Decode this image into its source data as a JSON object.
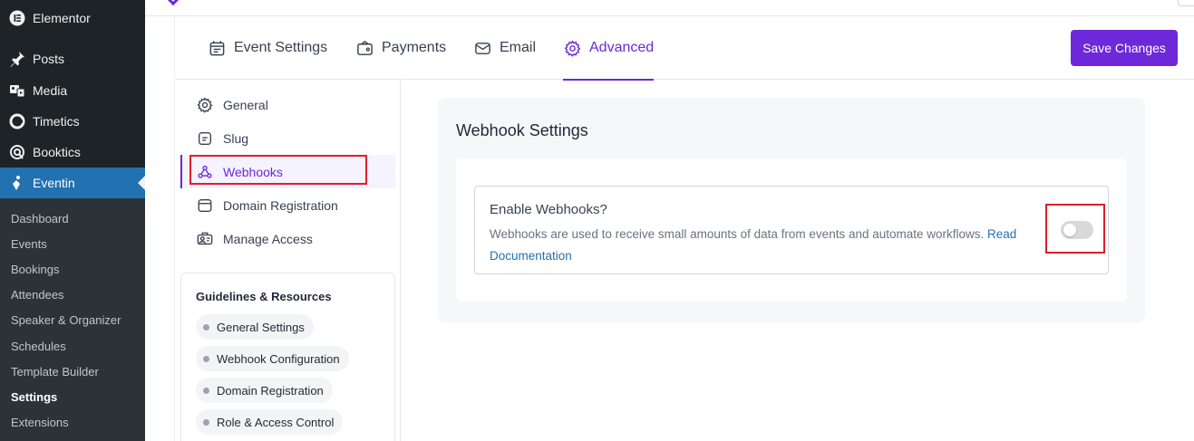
{
  "wp_menu": {
    "items": [
      {
        "label": "Elementor",
        "icon": "elementor-icon"
      },
      {
        "label": "Posts",
        "icon": "pin-icon"
      },
      {
        "label": "Media",
        "icon": "media-icon"
      },
      {
        "label": "Timetics",
        "icon": "timetics-icon"
      },
      {
        "label": "Booktics",
        "icon": "booktics-icon"
      },
      {
        "label": "Eventin",
        "icon": "eventin-icon"
      }
    ],
    "submenu": [
      "Dashboard",
      "Events",
      "Bookings",
      "Attendees",
      "Speaker & Organizer",
      "Schedules",
      "Template Builder",
      "Settings",
      "Extensions"
    ]
  },
  "tabs": [
    {
      "label": "Event Settings",
      "icon": "event-settings-icon"
    },
    {
      "label": "Payments",
      "icon": "payments-icon"
    },
    {
      "label": "Email",
      "icon": "email-icon"
    },
    {
      "label": "Advanced",
      "icon": "gear-icon"
    }
  ],
  "save_label": "Save Changes",
  "settings_nav": [
    {
      "label": "General",
      "icon": "gear-icon"
    },
    {
      "label": "Slug",
      "icon": "slug-icon"
    },
    {
      "label": "Webhooks",
      "icon": "webhook-icon"
    },
    {
      "label": "Domain Registration",
      "icon": "domain-icon"
    },
    {
      "label": "Manage Access",
      "icon": "users-icon"
    }
  ],
  "guidelines": {
    "title": "Guidelines & Resources",
    "links": [
      "General Settings",
      "Webhook Configuration",
      "Domain Registration",
      "Role & Access Control"
    ]
  },
  "panel": {
    "title": "Webhook Settings",
    "setting_title": "Enable Webhooks?",
    "description": "Webhooks are used to receive small amounts of data from events and automate workflows.",
    "link_text_1": "Read",
    "link_text_2": "Documentation",
    "toggle_enabled": false
  },
  "colors": {
    "accent": "#6d28d9",
    "wp_sidebar": "#1d2327",
    "wp_active": "#2271b1",
    "highlight": "#e11d2a"
  }
}
